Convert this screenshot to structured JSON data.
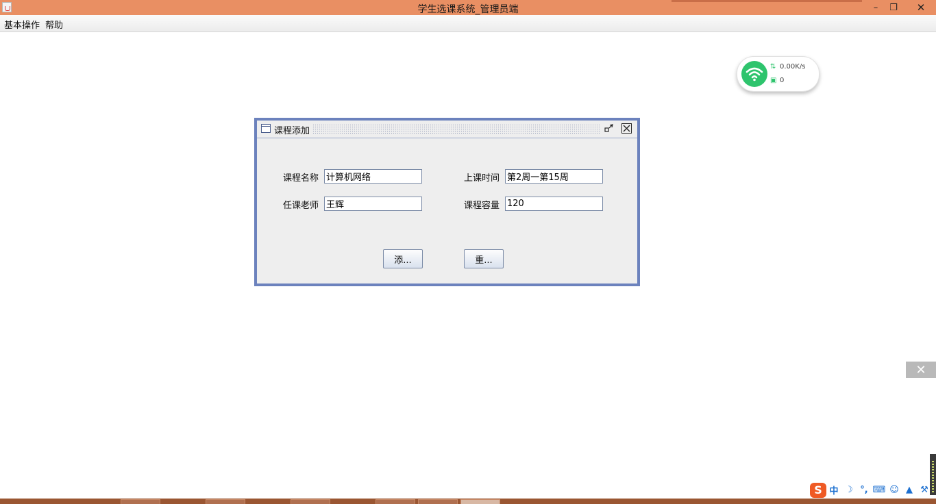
{
  "window": {
    "title": "学生选课系统_管理员端",
    "minimize_glyph": "–",
    "restore_glyph": "❐",
    "close_glyph": "✕"
  },
  "menu": {
    "items": [
      "基本操作",
      "帮助"
    ]
  },
  "network_widget": {
    "speed": "0.00K/s",
    "count": "0",
    "accent_color": "#2ec46d"
  },
  "course_add_dialog": {
    "title": "课程添加",
    "fields": {
      "course_name": {
        "label": "课程名称",
        "value": "计算机网络"
      },
      "class_time": {
        "label": "上课时间",
        "value": "第2周一第15周"
      },
      "teacher": {
        "label": "任课老师",
        "value": "王辉"
      },
      "capacity": {
        "label": "课程容量",
        "value": "120"
      }
    },
    "buttons": {
      "add": "添...",
      "reset": "重..."
    },
    "frame_color": "#6c82bd"
  },
  "notification": {
    "close_glyph": "✕"
  },
  "ime": {
    "logo": "S",
    "mode": "中",
    "items": [
      "☽",
      "°,",
      "⌨",
      "☺",
      "▲",
      "⚒"
    ]
  },
  "colors": {
    "titlebar": "#e98f63",
    "taskbar": "#9a5632"
  }
}
